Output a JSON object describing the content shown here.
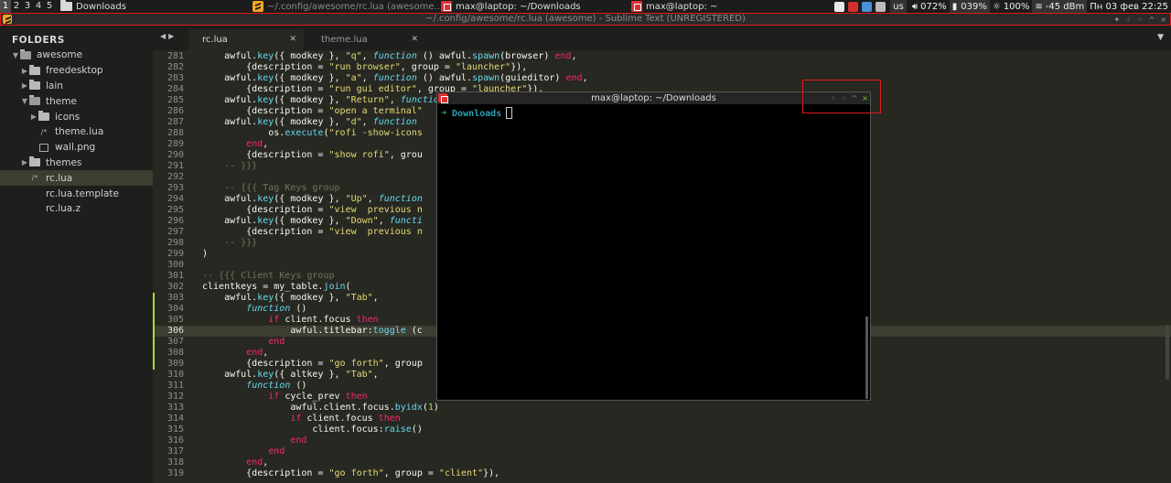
{
  "wibar": {
    "tags": [
      {
        "label": "1",
        "active": true
      },
      {
        "label": "2",
        "active": false
      },
      {
        "label": "3",
        "active": false
      },
      {
        "label": "4",
        "active": false
      },
      {
        "label": "5",
        "active": false
      }
    ],
    "tasks": [
      {
        "icon": "folder-icon",
        "label": "Downloads",
        "dim": false,
        "width": 210
      },
      {
        "icon": "sublime-text-icon",
        "label": "~/.config/awesome/rc.lua (awesome...",
        "dim": true,
        "width": 206
      },
      {
        "icon": "terminal-icon",
        "label": "max@laptop: ~/Downloads",
        "dim": false,
        "width": 208
      },
      {
        "icon": "terminal-icon",
        "label": "max@laptop: ~",
        "dim": false,
        "width": 190
      }
    ],
    "tray_colors": [
      "#e8e8e8",
      "#d32f2f",
      "#4a90d9",
      "#bbbbbb"
    ],
    "keyboard_layout": "us",
    "volume": "072%",
    "battery": "039%",
    "brightness": "100%",
    "wifi": "-45 dBm",
    "clock": "Пн 03 фев 22:25"
  },
  "sublime": {
    "window_title": "~/.config/awesome/rc.lua (awesome) - Sublime Text (UNREGISTERED)",
    "tabs": [
      {
        "label": "rc.lua",
        "active": true
      },
      {
        "label": "theme.lua",
        "active": false
      }
    ]
  },
  "sidebar": {
    "header": "FOLDERS",
    "items": [
      {
        "label": "awesome",
        "kind": "folder-open",
        "depth": 0,
        "selected": false
      },
      {
        "label": "freedesktop",
        "kind": "folder",
        "depth": 1,
        "selected": false
      },
      {
        "label": "lain",
        "kind": "folder",
        "depth": 1,
        "selected": false
      },
      {
        "label": "theme",
        "kind": "folder-open",
        "depth": 1,
        "selected": false
      },
      {
        "label": "icons",
        "kind": "folder",
        "depth": 2,
        "selected": false
      },
      {
        "label": "theme.lua",
        "kind": "script",
        "depth": 2,
        "selected": false
      },
      {
        "label": "wall.png",
        "kind": "image",
        "depth": 2,
        "selected": false
      },
      {
        "label": "themes",
        "kind": "folder",
        "depth": 1,
        "selected": false
      },
      {
        "label": "rc.lua",
        "kind": "script",
        "depth": 1,
        "selected": true
      },
      {
        "label": "rc.lua.template",
        "kind": "file",
        "depth": 1,
        "selected": false
      },
      {
        "label": "rc.lua.z",
        "kind": "file",
        "depth": 1,
        "selected": false
      }
    ]
  },
  "editor": {
    "current_line": 306,
    "modified_lines": [
      303,
      304,
      305,
      306,
      307,
      308,
      309
    ],
    "lines": [
      {
        "n": 281,
        "t": [
          {
            "x": "    awful."
          },
          {
            "x": "key",
            "c": "n"
          },
          {
            "x": "({ modkey }, "
          },
          {
            "x": "\"q\"",
            "c": "s"
          },
          {
            "x": ", "
          },
          {
            "x": "function",
            "c": "f"
          },
          {
            "x": " () awful."
          },
          {
            "x": "spawn",
            "c": "n"
          },
          {
            "x": "(browser) "
          },
          {
            "x": "end",
            "c": "k"
          },
          {
            "x": ","
          }
        ]
      },
      {
        "n": 282,
        "t": [
          {
            "x": "        {description = "
          },
          {
            "x": "\"run browser\"",
            "c": "s"
          },
          {
            "x": ", group = "
          },
          {
            "x": "\"launcher\"",
            "c": "s"
          },
          {
            "x": "}),"
          }
        ]
      },
      {
        "n": 283,
        "t": [
          {
            "x": "    awful."
          },
          {
            "x": "key",
            "c": "n"
          },
          {
            "x": "({ modkey }, "
          },
          {
            "x": "\"a\"",
            "c": "s"
          },
          {
            "x": ", "
          },
          {
            "x": "function",
            "c": "f"
          },
          {
            "x": " () awful."
          },
          {
            "x": "spawn",
            "c": "n"
          },
          {
            "x": "(guieditor) "
          },
          {
            "x": "end",
            "c": "k"
          },
          {
            "x": ","
          }
        ]
      },
      {
        "n": 284,
        "t": [
          {
            "x": "        {description = "
          },
          {
            "x": "\"run gui editor\"",
            "c": "s"
          },
          {
            "x": ", group = "
          },
          {
            "x": "\"launcher\"",
            "c": "s"
          },
          {
            "x": "}),"
          }
        ]
      },
      {
        "n": 285,
        "t": [
          {
            "x": "    awful."
          },
          {
            "x": "key",
            "c": "n"
          },
          {
            "x": "({ modkey }, "
          },
          {
            "x": "\"Return\"",
            "c": "s"
          },
          {
            "x": ", "
          },
          {
            "x": "function",
            "c": "f"
          }
        ]
      },
      {
        "n": 286,
        "t": [
          {
            "x": "        {description = "
          },
          {
            "x": "\"open a terminal\"",
            "c": "s"
          }
        ]
      },
      {
        "n": 287,
        "t": [
          {
            "x": "    awful."
          },
          {
            "x": "key",
            "c": "n"
          },
          {
            "x": "({ modkey }, "
          },
          {
            "x": "\"d\"",
            "c": "s"
          },
          {
            "x": ", "
          },
          {
            "x": "function",
            "c": "f"
          }
        ]
      },
      {
        "n": 288,
        "t": [
          {
            "x": "            os."
          },
          {
            "x": "execute",
            "c": "n"
          },
          {
            "x": "("
          },
          {
            "x": "\"rofi -show-icons",
            "c": "s"
          }
        ]
      },
      {
        "n": 289,
        "t": [
          {
            "x": "        "
          },
          {
            "x": "end",
            "c": "k"
          },
          {
            "x": ","
          }
        ]
      },
      {
        "n": 290,
        "t": [
          {
            "x": "        {description = "
          },
          {
            "x": "\"show rofi\"",
            "c": "s"
          },
          {
            "x": ", grou"
          }
        ]
      },
      {
        "n": 291,
        "t": [
          {
            "x": "    -- }}}",
            "c": "c"
          }
        ]
      },
      {
        "n": 292,
        "t": []
      },
      {
        "n": 293,
        "t": [
          {
            "x": "    -- {{{ Tag Keys group",
            "c": "c"
          }
        ]
      },
      {
        "n": 294,
        "t": [
          {
            "x": "    awful."
          },
          {
            "x": "key",
            "c": "n"
          },
          {
            "x": "({ modkey }, "
          },
          {
            "x": "\"Up\"",
            "c": "s"
          },
          {
            "x": ", "
          },
          {
            "x": "function",
            "c": "f"
          }
        ]
      },
      {
        "n": 295,
        "t": [
          {
            "x": "        {description = "
          },
          {
            "x": "\"view  previous n",
            "c": "s"
          }
        ]
      },
      {
        "n": 296,
        "t": [
          {
            "x": "    awful."
          },
          {
            "x": "key",
            "c": "n"
          },
          {
            "x": "({ modkey }, "
          },
          {
            "x": "\"Down\"",
            "c": "s"
          },
          {
            "x": ", "
          },
          {
            "x": "functi",
            "c": "f"
          }
        ]
      },
      {
        "n": 297,
        "t": [
          {
            "x": "        {description = "
          },
          {
            "x": "\"view  previous n",
            "c": "s"
          }
        ]
      },
      {
        "n": 298,
        "t": [
          {
            "x": "    -- }}}",
            "c": "c"
          }
        ]
      },
      {
        "n": 299,
        "t": [
          {
            "x": ")"
          }
        ]
      },
      {
        "n": 300,
        "t": []
      },
      {
        "n": 301,
        "t": [
          {
            "x": "-- {{{ Client Keys group",
            "c": "c"
          }
        ]
      },
      {
        "n": 302,
        "t": [
          {
            "x": "clientkeys = my_table."
          },
          {
            "x": "join",
            "c": "n"
          },
          {
            "x": "("
          }
        ]
      },
      {
        "n": 303,
        "t": [
          {
            "x": "    awful."
          },
          {
            "x": "key",
            "c": "n"
          },
          {
            "x": "({ modkey }, "
          },
          {
            "x": "\"Tab\"",
            "c": "s"
          },
          {
            "x": ","
          }
        ]
      },
      {
        "n": 304,
        "t": [
          {
            "x": "        "
          },
          {
            "x": "function",
            "c": "f"
          },
          {
            "x": " ()"
          }
        ]
      },
      {
        "n": 305,
        "t": [
          {
            "x": "            "
          },
          {
            "x": "if",
            "c": "k"
          },
          {
            "x": " client.focus "
          },
          {
            "x": "then",
            "c": "k"
          }
        ]
      },
      {
        "n": 306,
        "t": [
          {
            "x": "                awful.titlebar:"
          },
          {
            "x": "toggle",
            "c": "n"
          },
          {
            "x": " (c"
          }
        ]
      },
      {
        "n": 307,
        "t": [
          {
            "x": "            "
          },
          {
            "x": "end",
            "c": "k"
          }
        ]
      },
      {
        "n": 308,
        "t": [
          {
            "x": "        "
          },
          {
            "x": "end",
            "c": "k"
          },
          {
            "x": ","
          }
        ]
      },
      {
        "n": 309,
        "t": [
          {
            "x": "        {description = "
          },
          {
            "x": "\"go forth\"",
            "c": "s"
          },
          {
            "x": ", group"
          }
        ]
      },
      {
        "n": 310,
        "t": [
          {
            "x": "    awful."
          },
          {
            "x": "key",
            "c": "n"
          },
          {
            "x": "({ altkey }, "
          },
          {
            "x": "\"Tab\"",
            "c": "s"
          },
          {
            "x": ","
          }
        ]
      },
      {
        "n": 311,
        "t": [
          {
            "x": "        "
          },
          {
            "x": "function",
            "c": "f"
          },
          {
            "x": " ()"
          }
        ]
      },
      {
        "n": 312,
        "t": [
          {
            "x": "            "
          },
          {
            "x": "if",
            "c": "k"
          },
          {
            "x": " cycle_prev "
          },
          {
            "x": "then",
            "c": "k"
          }
        ]
      },
      {
        "n": 313,
        "t": [
          {
            "x": "                awful.client.focus."
          },
          {
            "x": "byidx",
            "c": "n"
          },
          {
            "x": "("
          },
          {
            "x": "1",
            "c": "b"
          },
          {
            "x": ")"
          }
        ]
      },
      {
        "n": 314,
        "t": [
          {
            "x": "                "
          },
          {
            "x": "if",
            "c": "k"
          },
          {
            "x": " client.focus "
          },
          {
            "x": "then",
            "c": "k"
          }
        ]
      },
      {
        "n": 315,
        "t": [
          {
            "x": "                    client.focus:"
          },
          {
            "x": "raise",
            "c": "n"
          },
          {
            "x": "()"
          }
        ]
      },
      {
        "n": 316,
        "t": [
          {
            "x": "                "
          },
          {
            "x": "end",
            "c": "k"
          }
        ]
      },
      {
        "n": 317,
        "t": [
          {
            "x": "            "
          },
          {
            "x": "end",
            "c": "k"
          }
        ]
      },
      {
        "n": 318,
        "t": [
          {
            "x": "        "
          },
          {
            "x": "end",
            "c": "k"
          },
          {
            "x": ","
          }
        ]
      },
      {
        "n": 319,
        "t": [
          {
            "x": "        {description = "
          },
          {
            "x": "\"go forth\"",
            "c": "s"
          },
          {
            "x": ", group = "
          },
          {
            "x": "\"client\"",
            "c": "s"
          },
          {
            "x": "}),"
          }
        ]
      }
    ]
  },
  "terminal": {
    "title": "max@laptop: ~/Downloads",
    "prompt_arrow": "➜",
    "prompt_dir": "Downloads"
  }
}
